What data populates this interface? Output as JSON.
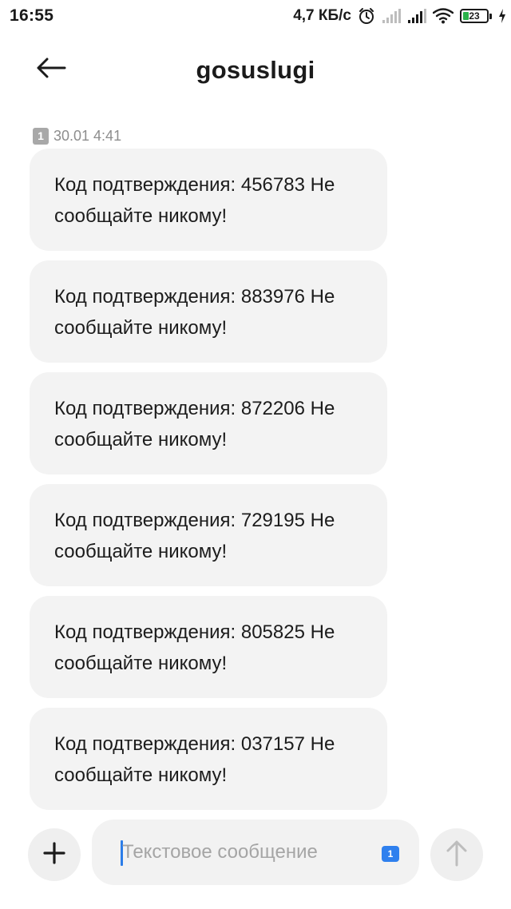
{
  "status_bar": {
    "time": "16:55",
    "network_speed": "4,7 КБ/с",
    "battery_level": "23",
    "icons": [
      "alarm-icon",
      "signal-icon",
      "signal-icon",
      "wifi-icon",
      "battery-icon",
      "charging-icon"
    ]
  },
  "header": {
    "title": "gosuslugi",
    "back_icon": "arrow-left-icon"
  },
  "thread": {
    "sim_badge": "1",
    "timestamp": "30.01 4:41",
    "messages": [
      "Код подтверждения: 456783 Не сообщайте никому!",
      "Код подтверждения: 883976 Не сообщайте никому!",
      "Код подтверждения: 872206 Не сообщайте никому!",
      "Код подтверждения: 729195 Не сообщайте никому!",
      "Код подтверждения: 805825 Не сообщайте никому!",
      "Код подтверждения: 037157 Не сообщайте никому!"
    ]
  },
  "compose": {
    "placeholder": "Текстовое сообщение",
    "value": "",
    "sim_select": "1",
    "attach_icon": "plus-icon",
    "send_icon": "arrow-up-icon"
  },
  "colors": {
    "bubble": "#f3f3f3",
    "accent": "#2f80ee",
    "battery_fill": "#2ab24a"
  }
}
